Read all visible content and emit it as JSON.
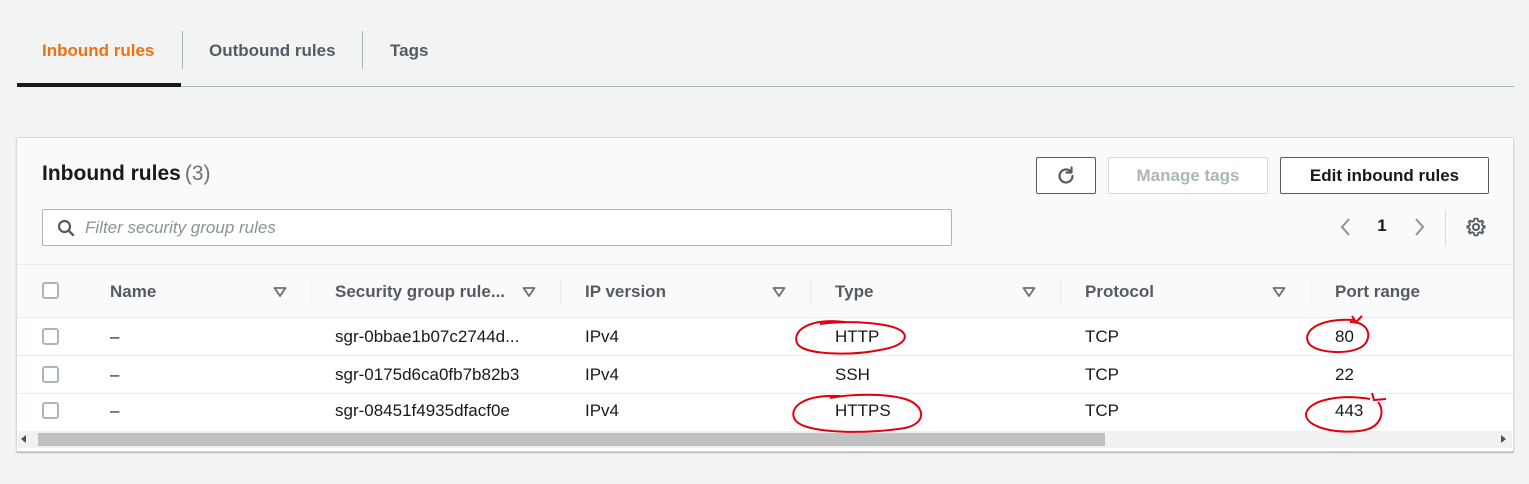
{
  "tabs": [
    {
      "label": "Inbound rules",
      "active": true
    },
    {
      "label": "Outbound rules",
      "active": false
    },
    {
      "label": "Tags",
      "active": false
    }
  ],
  "panel": {
    "title": "Inbound rules",
    "count": "(3)",
    "buttons": {
      "refresh_icon": "refresh-icon",
      "manage_tags": "Manage tags",
      "edit_inbound_rules": "Edit inbound rules"
    },
    "search": {
      "placeholder": "Filter security group rules",
      "value": ""
    },
    "pagination": {
      "current_page": "1"
    }
  },
  "table": {
    "columns": [
      "Name",
      "Security group rule...",
      "IP version",
      "Type",
      "Protocol",
      "Port range"
    ],
    "rows": [
      {
        "name": "–",
        "rule_id": "sgr-0bbae1b07c2744d...",
        "ip_version": "IPv4",
        "type": "HTTP",
        "protocol": "TCP",
        "port_range": "80"
      },
      {
        "name": "–",
        "rule_id": "sgr-0175d6ca0fb7b82b3",
        "ip_version": "IPv4",
        "type": "SSH",
        "protocol": "TCP",
        "port_range": "22"
      },
      {
        "name": "–",
        "rule_id": "sgr-08451f4935dfacf0e",
        "ip_version": "IPv4",
        "type": "HTTPS",
        "protocol": "TCP",
        "port_range": "443"
      }
    ]
  },
  "colors": {
    "active_tab": "#ec7211",
    "text_primary": "#16191f",
    "text_secondary": "#545b64",
    "annotation": "#e0000f"
  }
}
